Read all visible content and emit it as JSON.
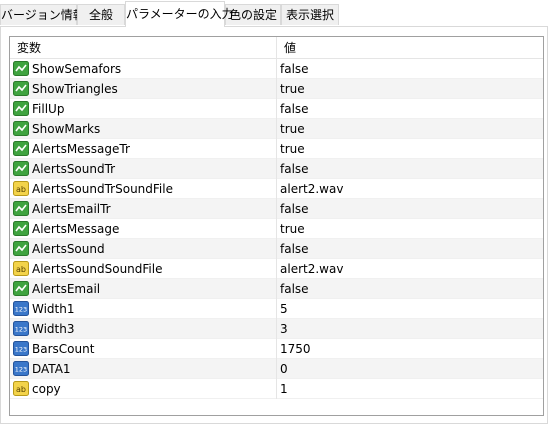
{
  "tabs": [
    {
      "label": "バージョン情報",
      "active": false
    },
    {
      "label": "全般",
      "active": false
    },
    {
      "label": "パラメーターの入力",
      "active": true
    },
    {
      "label": "色の設定",
      "active": false
    },
    {
      "label": "表示選択",
      "active": false
    }
  ],
  "table": {
    "headers": {
      "name": "変数",
      "value": "値"
    },
    "rows": [
      {
        "name": "ShowSemafors",
        "value": "false",
        "type": "bool"
      },
      {
        "name": "ShowTriangles",
        "value": "true",
        "type": "bool"
      },
      {
        "name": "FillUp",
        "value": "false",
        "type": "bool"
      },
      {
        "name": "ShowMarks",
        "value": "true",
        "type": "bool"
      },
      {
        "name": "AlertsMessageTr",
        "value": "true",
        "type": "bool"
      },
      {
        "name": "AlertsSoundTr",
        "value": "false",
        "type": "bool"
      },
      {
        "name": "AlertsSoundTrSoundFile",
        "value": "alert2.wav",
        "type": "string"
      },
      {
        "name": "AlertsEmailTr",
        "value": "false",
        "type": "bool"
      },
      {
        "name": "AlertsMessage",
        "value": "true",
        "type": "bool"
      },
      {
        "name": "AlertsSound",
        "value": "false",
        "type": "bool"
      },
      {
        "name": "AlertsSoundSoundFile",
        "value": "alert2.wav",
        "type": "string"
      },
      {
        "name": "AlertsEmail",
        "value": "false",
        "type": "bool"
      },
      {
        "name": "Width1",
        "value": "5",
        "type": "int"
      },
      {
        "name": "Width3",
        "value": "3",
        "type": "int"
      },
      {
        "name": "BarsCount",
        "value": "1750",
        "type": "int"
      },
      {
        "name": "DATA1",
        "value": "0",
        "type": "int"
      },
      {
        "name": "copy",
        "value": "1",
        "type": "string"
      }
    ]
  },
  "icons": {
    "bool": "bool-param-icon",
    "string": "string-param-icon",
    "int": "int-param-icon"
  },
  "colors": {
    "bool_icon_bg": "#3fa33f",
    "string_icon_bg": "#f3d34a",
    "int_icon_bg": "#3a77c9",
    "alt_row": "#f4f4f4"
  }
}
